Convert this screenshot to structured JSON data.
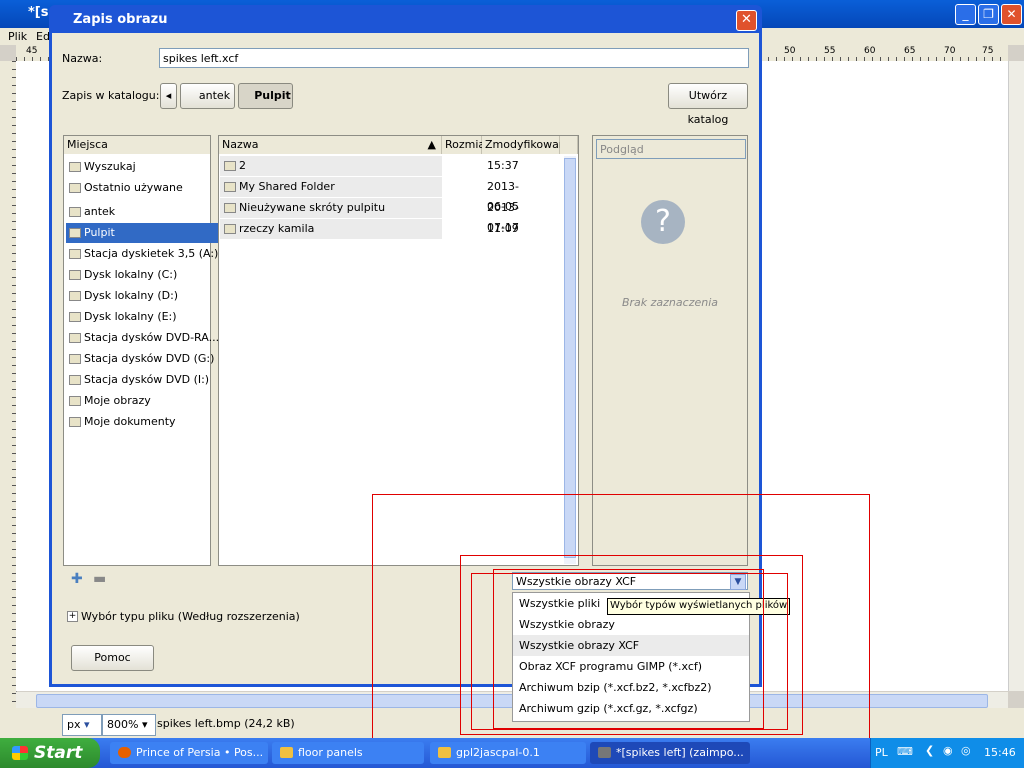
{
  "gimp": {
    "title": "*[sp",
    "menu": [
      "Plik",
      "Ed"
    ],
    "ruler_labels": [
      "45",
      "50",
      "55",
      "60",
      "65",
      "70",
      "75"
    ],
    "unit": "px",
    "zoom": "800%",
    "status_text": "spikes left.bmp (24,2 kB)"
  },
  "dialog": {
    "title": "Zapis obrazu",
    "name_label": "Nazwa:",
    "filename": "spikes left.xcf",
    "folder_label": "Zapis w katalogu:",
    "path": [
      "antek",
      "Pulpit"
    ],
    "create_folder": "Utwórz katalog",
    "places_header": "Miejsca",
    "places": [
      "Wyszukaj",
      "Ostatnio używane",
      "antek",
      "Pulpit",
      "Stacja dyskietek 3,5 (A:)",
      "Dysk lokalny (C:)",
      "Dysk lokalny (D:)",
      "Dysk lokalny (E:)",
      "Stacja dysków DVD-RA...",
      "Stacja dysków DVD (G:)",
      "Stacja dysków DVD (I:)",
      "Moje obrazy",
      "Moje dokumenty"
    ],
    "columns": {
      "name": "Nazwa",
      "size": "Rozmiar",
      "modified": "Zmodyfikowany"
    },
    "files": [
      {
        "name": "2",
        "modified": "15:37"
      },
      {
        "name": "My Shared Folder",
        "modified": "2013-06-05"
      },
      {
        "name": "Nieużywane skróty pulpitu",
        "modified": "2013-07-17"
      },
      {
        "name": "rzeczy kamila",
        "modified": "11:09"
      }
    ],
    "preview_label": "Podgląd",
    "no_selection": "Brak zaznaczenia",
    "filetype_expander": "Wybór typu pliku (Według rozszerzenia)",
    "help_button": "Pomoc",
    "filter_selected": "Wszystkie obrazy XCF",
    "filter_options": [
      "Wszystkie pliki",
      "Wszystkie obrazy",
      "Wszystkie obrazy XCF",
      "Obraz XCF programu GIMP (*.xcf)",
      "Archiwum bzip (*.xcf.bz2, *.xcfbz2)",
      "Archiwum gzip (*.xcf.gz, *.xcfgz)"
    ],
    "tooltip": "Wybór typów wyświetlanych plików"
  },
  "taskbar": {
    "start": "Start",
    "tasks": [
      "Prince of Persia • Pos...",
      "floor panels",
      "gpl2jascpal-0.1",
      "*[spikes left] (zaimpo..."
    ],
    "lang": "PL",
    "clock": "15:46"
  },
  "colors": {
    "xp_blue": "#1d55d6",
    "selection": "#316ac5",
    "highlight_box": "#e00000"
  }
}
